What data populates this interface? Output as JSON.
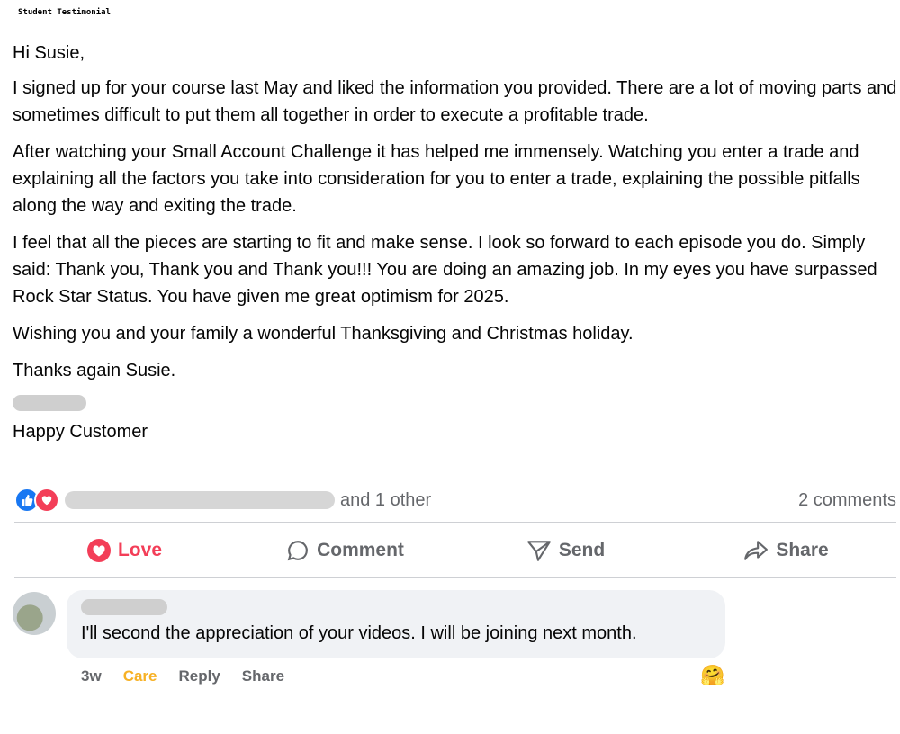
{
  "header": {
    "label": "Student Testimonial"
  },
  "post": {
    "greeting": "Hi Susie,",
    "paragraphs": [
      "I signed up for your course last May and liked the information you provided.  There are a lot of moving parts and sometimes difficult to put them all together in order to execute a profitable trade.",
      "After watching your Small Account Challenge it has helped me immensely.  Watching you enter a trade and explaining all the factors you take into consideration for you to enter a trade, explaining the possible pitfalls along the way and exiting the trade.",
      "I feel that all the pieces are starting to fit and make sense.  I look so forward to each episode you do.  Simply said: Thank you, Thank you and Thank you!!!  You are doing an amazing job. In my eyes you have surpassed Rock Star Status.   You have given me great optimism for 2025.",
      "Wishing you and your family a wonderful Thanksgiving and Christmas holiday.",
      "Thanks again Susie."
    ],
    "signoff": "Happy Customer"
  },
  "reactions": {
    "icons": [
      "like-icon",
      "love-icon"
    ],
    "others_text": "and 1 other",
    "comments_count": "2 comments"
  },
  "actions": {
    "love": "Love",
    "comment": "Comment",
    "send": "Send",
    "share": "Share"
  },
  "comment": {
    "text": "I'll second the appreciation of your videos. I will be joining next month.",
    "time": "3w",
    "reaction": "Care",
    "reply": "Reply",
    "share": "Share",
    "emoji": "🤗"
  },
  "colors": {
    "accent_blue": "#1877f2",
    "love_red": "#f33e58",
    "care_yellow": "#f7b125",
    "meta_gray": "#65676b",
    "bubble_bg": "#f0f2f5"
  }
}
